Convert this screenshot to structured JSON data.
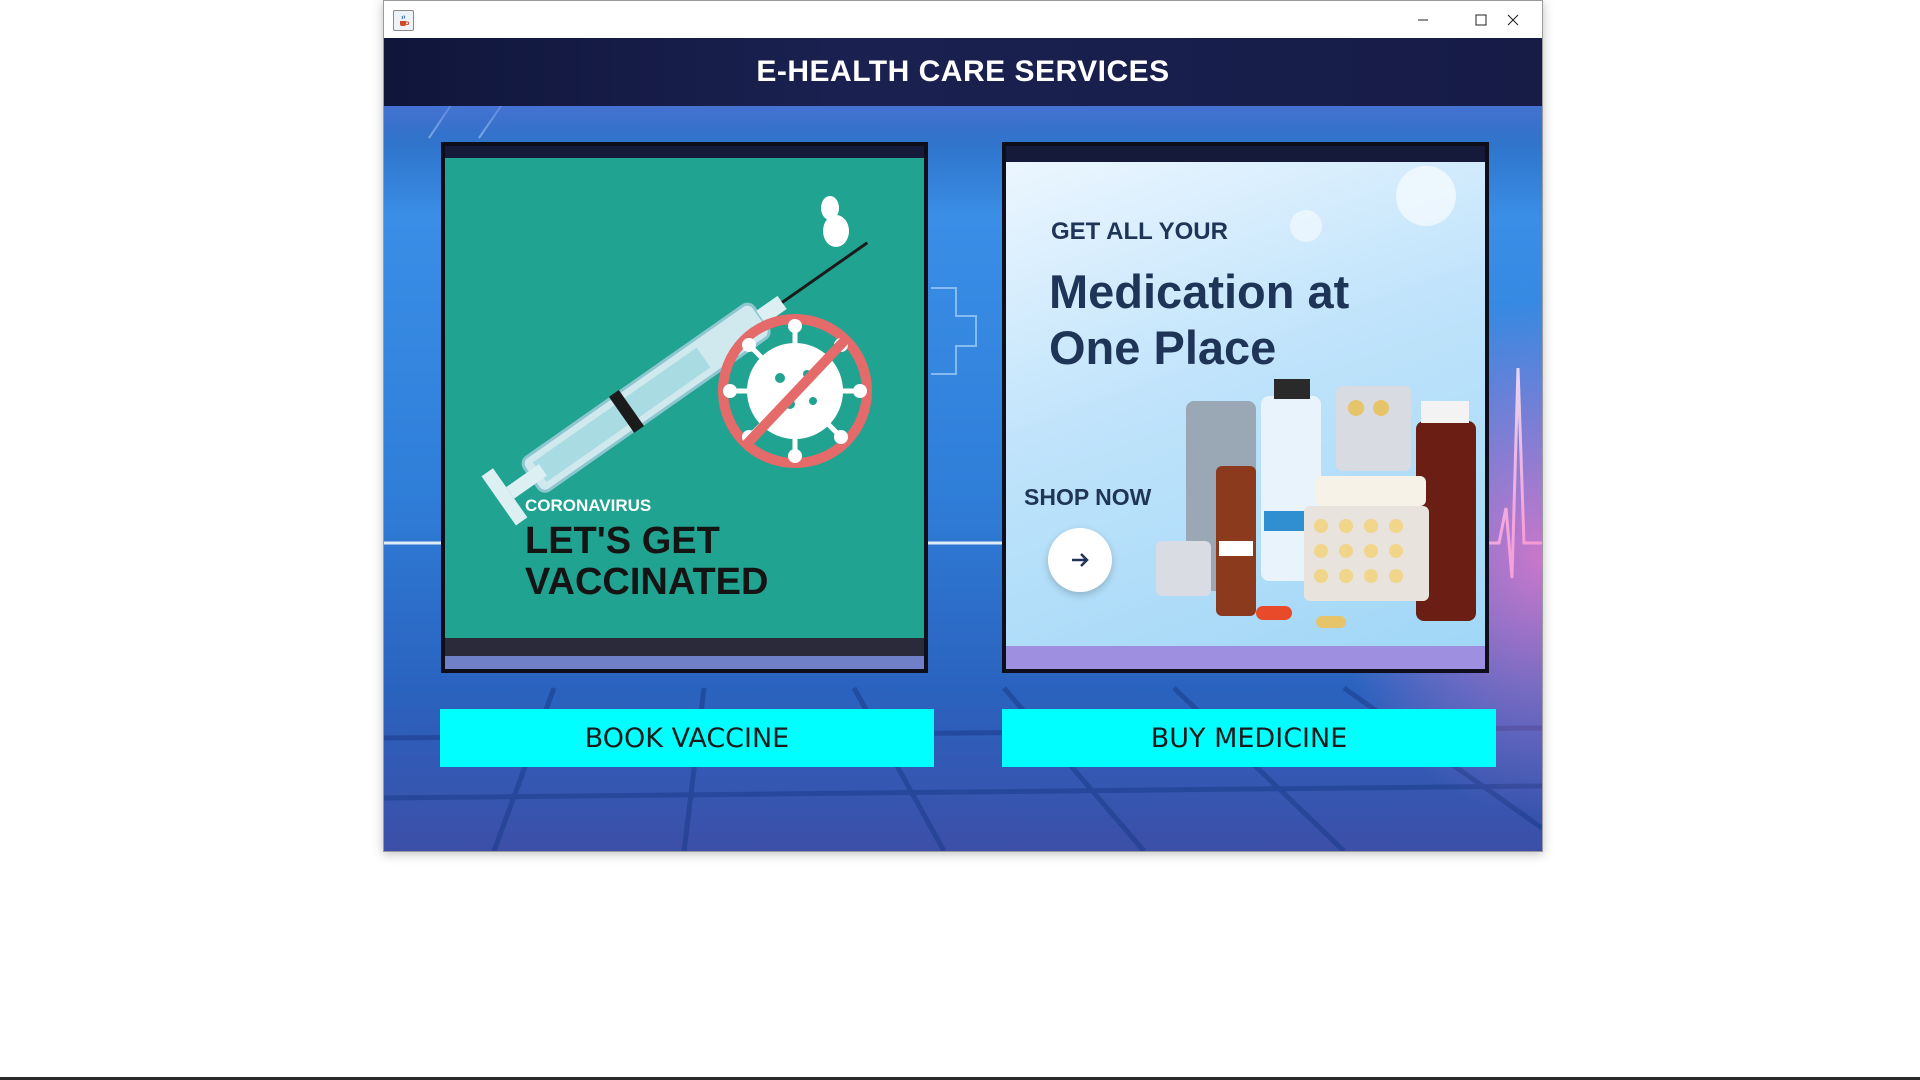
{
  "window": {
    "app_icon": "java-cup-icon",
    "controls": [
      "minimize-icon",
      "maximize-icon",
      "close-icon"
    ]
  },
  "header": {
    "title": "E-HEALTH CARE SERVICES"
  },
  "vaccine_card": {
    "kicker": "CORONAVIRUS",
    "headline": "LET'S GET VACCINATED",
    "button_label": "BOOK VACCINE",
    "background_color": "#21a391"
  },
  "medicine_card": {
    "kicker": "GET ALL YOUR",
    "headline": "Medication at One Place",
    "cta": "SHOP NOW",
    "button_label": "BUY MEDICINE"
  },
  "colors": {
    "header_bg": "#141a42",
    "button_bg": "#00ffff",
    "card_border": "#0e0e1a"
  }
}
